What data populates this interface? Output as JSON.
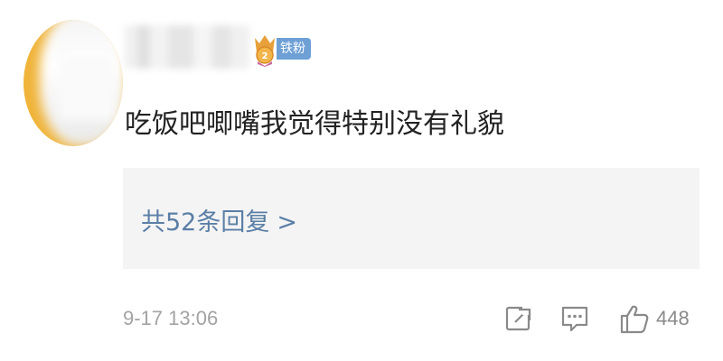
{
  "comment": {
    "fan_badge_label": "铁粉",
    "text": "吃饭吧唧嘴我觉得特别没有礼貌",
    "replies_label": "共52条回复",
    "replies_chevron": ">",
    "timestamp": "9-17 13:06",
    "like_count": "448"
  },
  "colors": {
    "link": "#5b7fa6",
    "badge": "#6ea0d6",
    "meta_text": "#a3a3a3",
    "reply_box_bg": "#f4f4f4"
  },
  "icons": [
    "share-icon",
    "reply-icon",
    "like-icon",
    "fan-crest-icon"
  ]
}
